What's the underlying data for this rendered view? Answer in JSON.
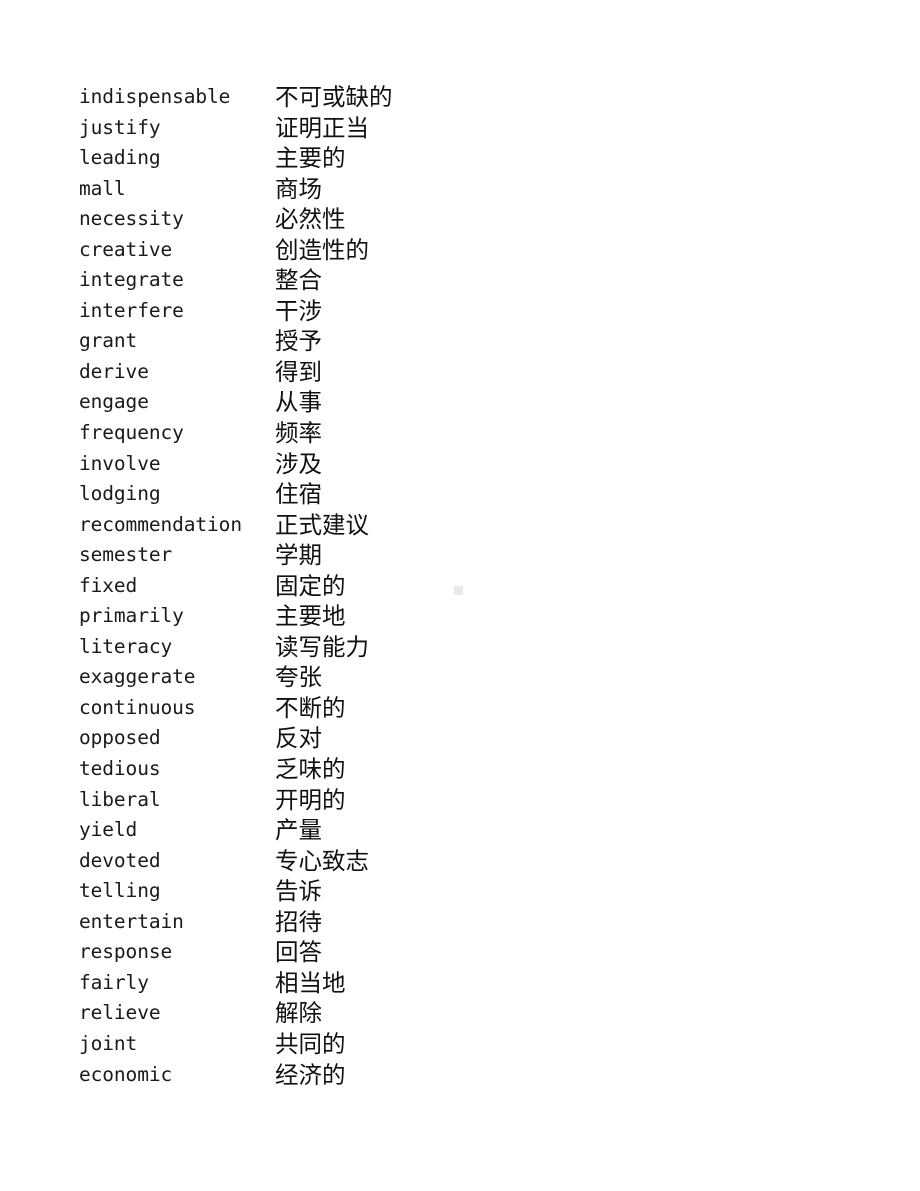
{
  "page": {
    "background_color": "#ffffff",
    "text_color": "#000000",
    "artifact_color": "#e9e9e9"
  },
  "vocabulary": {
    "columns": [
      "english",
      "chinese"
    ],
    "rows": [
      {
        "english": "indispensable",
        "chinese": "不可或缺的"
      },
      {
        "english": "justify",
        "chinese": "证明正当"
      },
      {
        "english": "leading",
        "chinese": "主要的"
      },
      {
        "english": "mall",
        "chinese": "商场"
      },
      {
        "english": "necessity",
        "chinese": "必然性"
      },
      {
        "english": "creative",
        "chinese": "创造性的"
      },
      {
        "english": "integrate",
        "chinese": "整合"
      },
      {
        "english": "interfere",
        "chinese": "干涉"
      },
      {
        "english": "grant",
        "chinese": "授予"
      },
      {
        "english": "derive",
        "chinese": "得到"
      },
      {
        "english": "engage",
        "chinese": "从事"
      },
      {
        "english": "frequency",
        "chinese": "频率"
      },
      {
        "english": "involve",
        "chinese": "涉及"
      },
      {
        "english": "lodging",
        "chinese": "住宿"
      },
      {
        "english": "recommendation",
        "chinese": "正式建议"
      },
      {
        "english": "semester",
        "chinese": "学期"
      },
      {
        "english": "fixed",
        "chinese": "固定的"
      },
      {
        "english": "primarily",
        "chinese": "主要地"
      },
      {
        "english": "literacy",
        "chinese": "读写能力"
      },
      {
        "english": "exaggerate",
        "chinese": "夸张"
      },
      {
        "english": "continuous",
        "chinese": "不断的"
      },
      {
        "english": "opposed",
        "chinese": "反对"
      },
      {
        "english": "tedious",
        "chinese": "乏味的"
      },
      {
        "english": "liberal",
        "chinese": "开明的"
      },
      {
        "english": "yield",
        "chinese": "产量"
      },
      {
        "english": "devoted",
        "chinese": "专心致志"
      },
      {
        "english": "telling",
        "chinese": "告诉"
      },
      {
        "english": "entertain",
        "chinese": "招待"
      },
      {
        "english": "response",
        "chinese": "回答"
      },
      {
        "english": "fairly",
        "chinese": "相当地"
      },
      {
        "english": "relieve",
        "chinese": "解除"
      },
      {
        "english": "joint",
        "chinese": "共同的"
      },
      {
        "english": "economic",
        "chinese": "经济的"
      }
    ]
  }
}
